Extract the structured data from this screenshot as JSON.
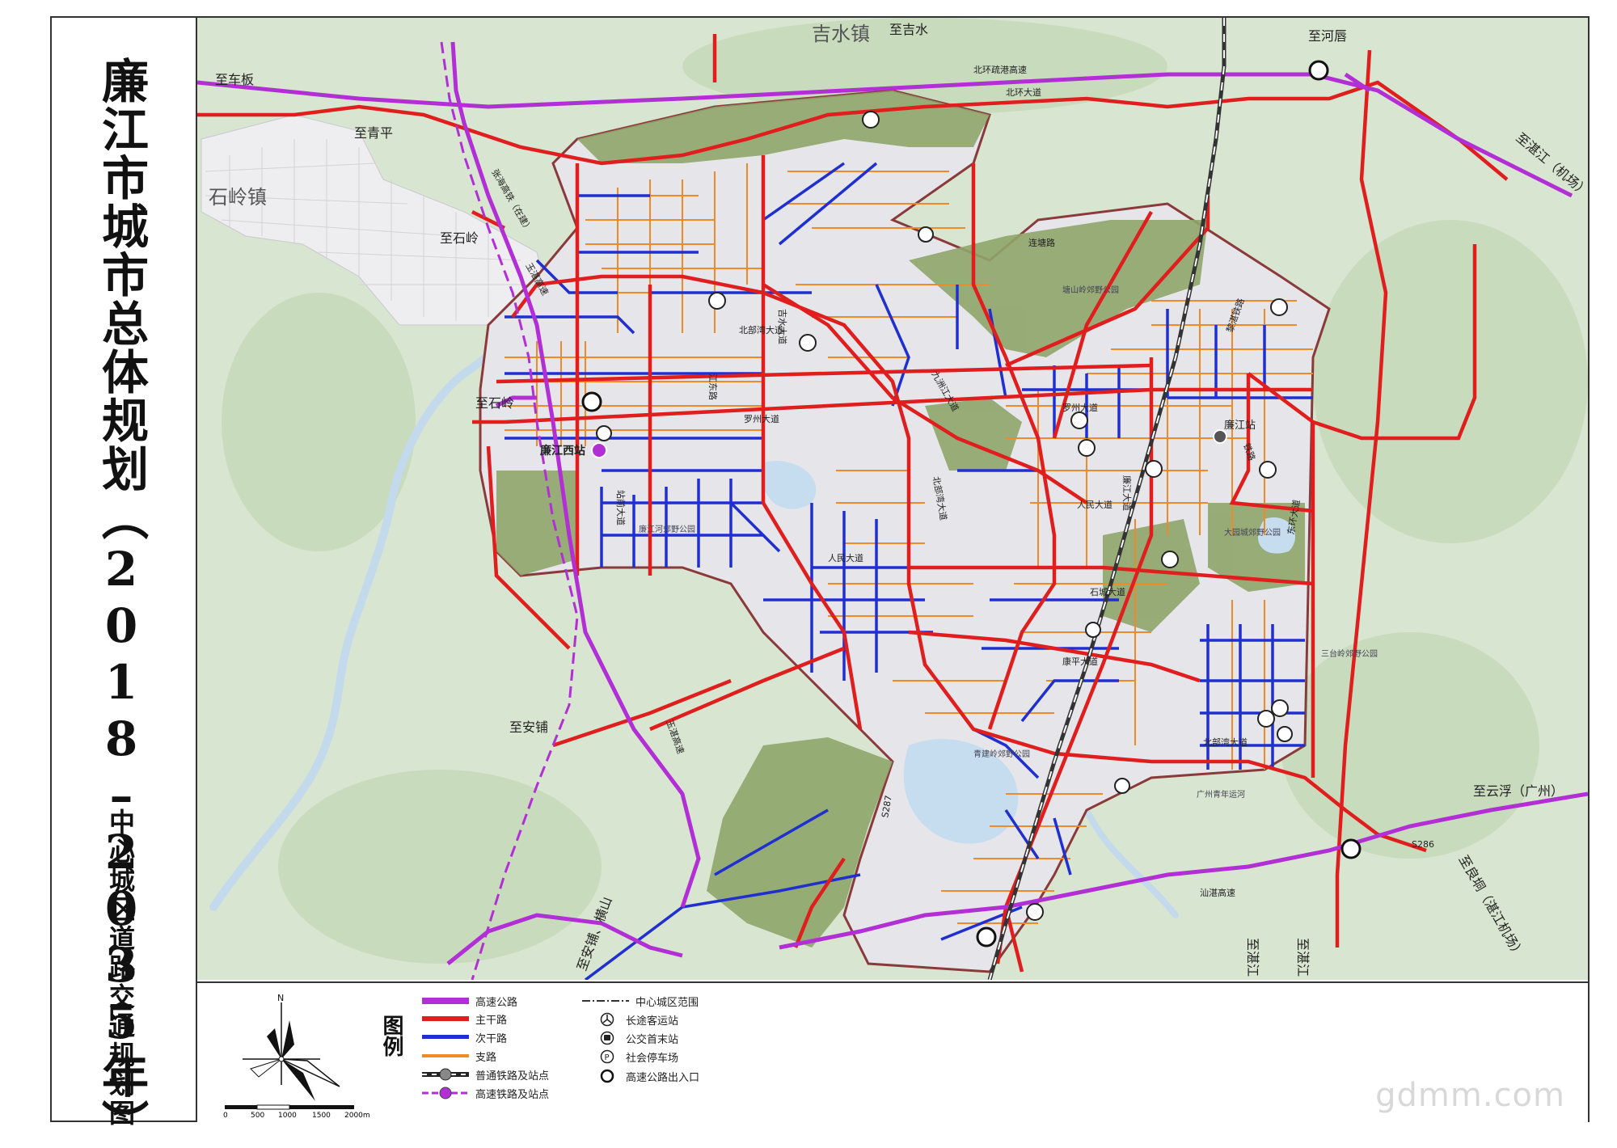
{
  "title": "廉江市城市总体规划（2018–2035年）",
  "subtitle": "中心城区道路交通规划图",
  "watermark": "gdmm.com",
  "colors": {
    "highway": "#b22fd6",
    "arterial": "#e01e1e",
    "secondary": "#1f2fd0",
    "branch": "#ef8a2a",
    "boundary": "#8a3a3a",
    "green": "#8fa56a",
    "urban": "#e6e6ea",
    "water": "#c9dff0",
    "bg": "#d9e6d2"
  },
  "map": {
    "towns": [
      "吉水镇",
      "石岭镇"
    ],
    "directions": [
      "至吉水",
      "至河唇",
      "至车板",
      "至青平",
      "至湛江（机场）",
      "至石岭",
      "至石岭",
      "至安铺",
      "至云浮（广州）",
      "至良垌（湛江机场）",
      "至湛江",
      "至湛江",
      "至安铺、横山"
    ],
    "roads": [
      "北环疏港高速",
      "北环大道",
      "连塘路",
      "北部湾大道",
      "罗州大道",
      "吉水大道",
      "江东路",
      "九洲江大道",
      "北部湾大道",
      "站前大道",
      "人民大道",
      "人民大道",
      "石城大道",
      "康平大道",
      "北部湾大道",
      "东环大道",
      "廉江大道",
      "铁路",
      "汕湛高速",
      "S287",
      "S286",
      "张海高铁（在建）",
      "玉湛高速",
      "玉湛高速",
      "黎湛铁路",
      "罗州大道"
    ],
    "stations": [
      "廉江西站",
      "廉江站"
    ],
    "parks": [
      "塘山岭郊野公园",
      "廉江河郊野公园",
      "大园城郊野公园",
      "三台岭郊野公园",
      "青建岭郊野公园",
      "广州青年运河"
    ]
  },
  "legend": {
    "heading": "图例",
    "items_left": [
      {
        "label": "高速公路",
        "icon": "highway-line"
      },
      {
        "label": "主干路",
        "icon": "arterial-line"
      },
      {
        "label": "次干路",
        "icon": "secondary-line"
      },
      {
        "label": "支路",
        "icon": "branch-line"
      },
      {
        "label": "普通铁路及站点",
        "icon": "rail-station"
      },
      {
        "label": "高速铁路及站点",
        "icon": "hsr-station"
      }
    ],
    "items_right": [
      {
        "label": "中心城区范围",
        "icon": "boundary-line"
      },
      {
        "label": "长途客运站",
        "icon": "coach-station-icon"
      },
      {
        "label": "公交首末站",
        "icon": "bus-terminal-icon"
      },
      {
        "label": "社会停车场",
        "icon": "parking-icon"
      },
      {
        "label": "高速公路出入口",
        "icon": "interchange-icon"
      }
    ],
    "north": "N",
    "scale_labels": [
      "0",
      "500",
      "1000",
      "1500",
      "2000m"
    ]
  }
}
